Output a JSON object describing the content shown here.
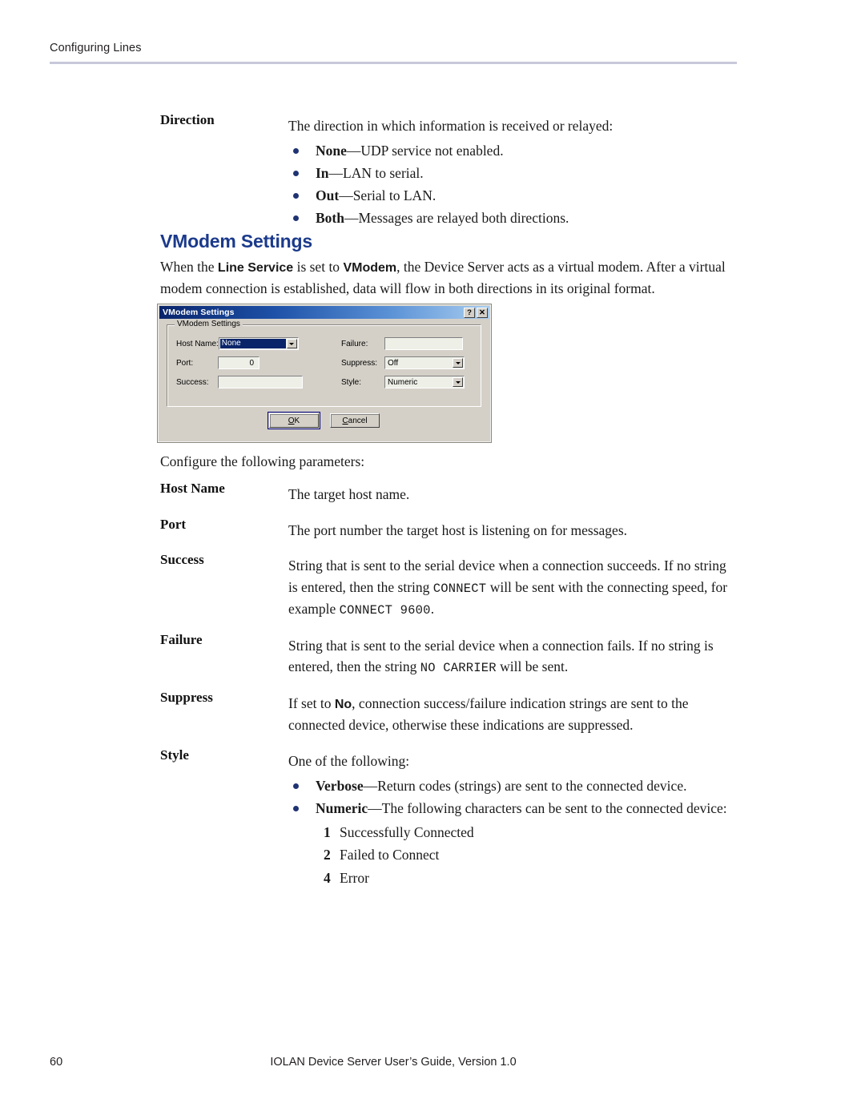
{
  "header": {
    "running_head": "Configuring Lines"
  },
  "direction": {
    "term": "Direction",
    "intro": "The direction in which information is received or relayed:",
    "options": [
      {
        "name": "None",
        "dash": "—",
        "text": "UDP service not enabled."
      },
      {
        "name": "In",
        "dash": "—",
        "text": "LAN to serial."
      },
      {
        "name": "Out",
        "dash": "—",
        "text": "Serial to LAN."
      },
      {
        "name": "Both",
        "dash": "—",
        "text": "Messages are relayed both directions."
      }
    ]
  },
  "section": {
    "heading": "VModem Settings",
    "intro_part1": "When the ",
    "intro_bold1": "Line Service",
    "intro_part2": " is set to ",
    "intro_bold2": "VModem",
    "intro_part3": ", the Device Server acts as a virtual modem. After a virtual modem connection is established, data will flow in both directions in its original format."
  },
  "dialog": {
    "title": "VModem Settings",
    "help_button": "?",
    "close_button": "✕",
    "group_legend": "VModem Settings",
    "fields": {
      "host_name_label": "Host Name:",
      "host_name_value": "None",
      "port_label": "Port:",
      "port_value": "0",
      "success_label": "Success:",
      "success_value": "",
      "failure_label": "Failure:",
      "failure_value": "",
      "suppress_label": "Suppress:",
      "suppress_value": "Off",
      "style_label": "Style:",
      "style_value": "Numeric"
    },
    "buttons": {
      "ok_accel": "O",
      "ok_rest": "K",
      "cancel_accel": "C",
      "cancel_rest": "ancel"
    }
  },
  "configure_intro": "Configure the following parameters:",
  "parameters": [
    {
      "term": "Host Name",
      "text": "The target host name."
    },
    {
      "term": "Port",
      "text": "The port number the target host is listening on for messages."
    },
    {
      "term": "Success",
      "part1": "String that is sent to the serial device when a connection succeeds. If no string is entered, then the string ",
      "code1": "CONNECT",
      "part2": " will be sent with the connecting speed, for example ",
      "code2": "CONNECT 9600",
      "part3": "."
    },
    {
      "term": "Failure",
      "part1": "String that is sent to the serial device when a connection fails. If no string is entered, then the string ",
      "code1": "NO CARRIER",
      "part2": " will be sent."
    },
    {
      "term": "Suppress",
      "part1": "If set to ",
      "bold1": "No",
      "part2": ", connection success/failure indication strings are sent to the connected device, otherwise these indications are suppressed."
    },
    {
      "term": "Style",
      "intro": "One of the following:",
      "options": [
        {
          "name": "Verbose",
          "dash": "—",
          "text": "Return codes (strings) are sent to the connected device."
        },
        {
          "name": "Numeric",
          "dash": "—",
          "text": "The following characters can be sent to the connected device:"
        }
      ],
      "codes": [
        {
          "num": "1",
          "text": "Successfully Connected"
        },
        {
          "num": "2",
          "text": "Failed to Connect"
        },
        {
          "num": "4",
          "text": "Error"
        }
      ]
    }
  ],
  "footer": {
    "page_number": "60",
    "document_title": "IOLAN Device Server User’s Guide, Version 1.0"
  },
  "colors": {
    "heading_blue": "#1b3a8c",
    "bullet_navy": "#1f3372",
    "rule_gray": "#c7c9da",
    "dialog_face": "#d4d0c8",
    "titlebar_blue": "#08246b",
    "selection_blue": "#0a246a"
  }
}
